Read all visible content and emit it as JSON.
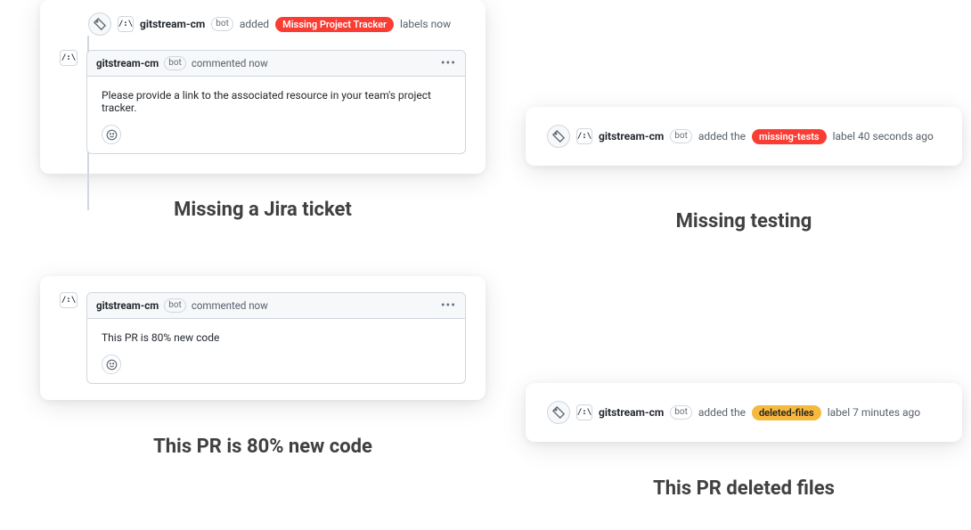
{
  "q1": {
    "event": {
      "actor": "gitstream-cm",
      "bot": "bot",
      "action": "added",
      "label": "Missing Project Tracker",
      "suffix": "labels now"
    },
    "comment": {
      "actor": "gitstream-cm",
      "bot": "bot",
      "meta": "commented now",
      "body": "Please provide a link to the associated resource in your team's project tracker."
    },
    "caption": "Missing a Jira ticket"
  },
  "q2": {
    "event": {
      "actor": "gitstream-cm",
      "bot": "bot",
      "action": "added the",
      "label": "missing-tests",
      "suffix": "label 40 seconds ago"
    },
    "caption": "Missing testing"
  },
  "q3": {
    "comment": {
      "actor": "gitstream-cm",
      "bot": "bot",
      "meta": "commented now",
      "body": "This PR is 80% new code"
    },
    "caption": "This PR is 80% new code"
  },
  "q4": {
    "event": {
      "actor": "gitstream-cm",
      "bot": "bot",
      "action": "added the",
      "label": "deleted-files",
      "suffix": "label 7 minutes ago"
    },
    "caption": "This PR deleted files"
  },
  "avatar_glyph": "/:\\"
}
